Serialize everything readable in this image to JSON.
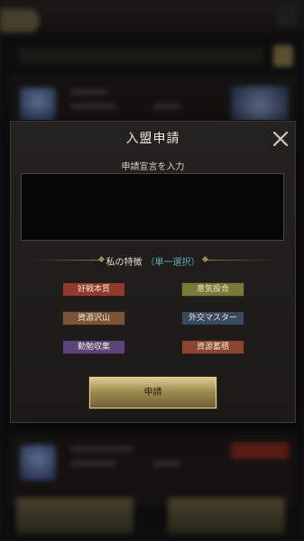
{
  "dialog": {
    "title": "入盟申請",
    "close_icon": "close-icon",
    "declaration_label": "申請宣言を入力",
    "declaration_value": "",
    "traits_title": "私の特徴",
    "traits_subtitle": "（単一選択）",
    "traits": [
      {
        "label": "好戦本質",
        "color": "#8e3a2c"
      },
      {
        "label": "意気投合",
        "color": "#7a7a38"
      },
      {
        "label": "資源沢山",
        "color": "#7a5438"
      },
      {
        "label": "外交マスター",
        "color": "#3a4860"
      },
      {
        "label": "勤勉収集",
        "color": "#5a4478"
      },
      {
        "label": "資源蓄積",
        "color": "#8a4430"
      }
    ],
    "apply_label": "申請"
  },
  "colors": {
    "panel_bg": "#1e1d1b",
    "accent_gold": "#b5a468",
    "subtitle_teal": "#5fa7b6"
  }
}
